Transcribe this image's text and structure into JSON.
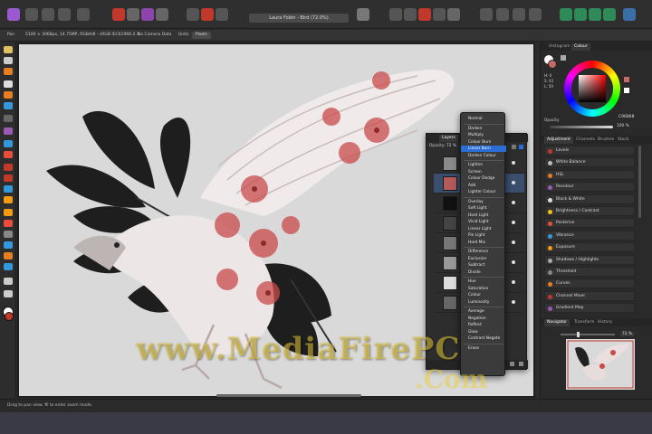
{
  "document": {
    "title": "Laura Fobin - Bird (72.0%)"
  },
  "context_toolbar": {
    "tool": "Pan",
    "info": "5100 × 3068px, 14.75MP, RGBA/8 - sRGB IEC61966-2.1",
    "colour": "No Camera Data",
    "units_label": "Units",
    "units_value": "Pixels"
  },
  "status_bar": {
    "text": "Drag to pan view. ⌘ to enter zoom mode."
  },
  "right_panel": {
    "top_tabs": [
      "Histogram",
      "Colour"
    ],
    "opacity_label": "Opacity",
    "opacity_value": "100 %",
    "hex_value": "C96868",
    "colour_values": [
      "H: 0",
      "S: 42",
      "L: 59"
    ],
    "adjustment_tabs": [
      "Adjustment",
      "Channels",
      "Brushes",
      "Stock"
    ],
    "adjustments": [
      "Levels",
      "White Balance",
      "HSL",
      "Recolour",
      "Black & White",
      "Brightness / Contrast",
      "Posterise",
      "Vibrance",
      "Exposure",
      "Shadows / Highlights",
      "Threshold",
      "Curves",
      "Channel Mixer",
      "Gradient Map"
    ],
    "nav_tabs": [
      "Navigator",
      "Transform",
      "History"
    ],
    "zoom_value": "72 %"
  },
  "layers_panel": {
    "tab": "Layers",
    "opacity_label": "Opacity:",
    "opacity_value": "72 %",
    "rows": 8
  },
  "blend_menu": {
    "items": [
      [
        "Normal"
      ],
      [
        "Darken",
        "Multiply",
        "Colour Burn",
        "Linear Burn",
        "Darken Colour"
      ],
      [
        "Lighten",
        "Screen",
        "Colour Dodge",
        "Add",
        "Lighter Colour"
      ],
      [
        "Overlay",
        "Soft Light",
        "Hard Light",
        "Vivid Light",
        "Linear Light",
        "Pin Light",
        "Hard Mix"
      ],
      [
        "Difference",
        "Exclusion",
        "Subtract",
        "Divide"
      ],
      [
        "Hue",
        "Saturation",
        "Colour",
        "Luminosity"
      ],
      [
        "Average",
        "Negation",
        "Reflect",
        "Glow",
        "Contrast Negate"
      ],
      [
        "Erase"
      ]
    ],
    "selected": "Linear Burn"
  },
  "watermark": {
    "line1": "www.MediaFirePC",
    "line2": ".Com"
  },
  "colors": {
    "accent": "#2a6fd6",
    "swatch": "#c96868",
    "flower": "#c94a4a"
  }
}
